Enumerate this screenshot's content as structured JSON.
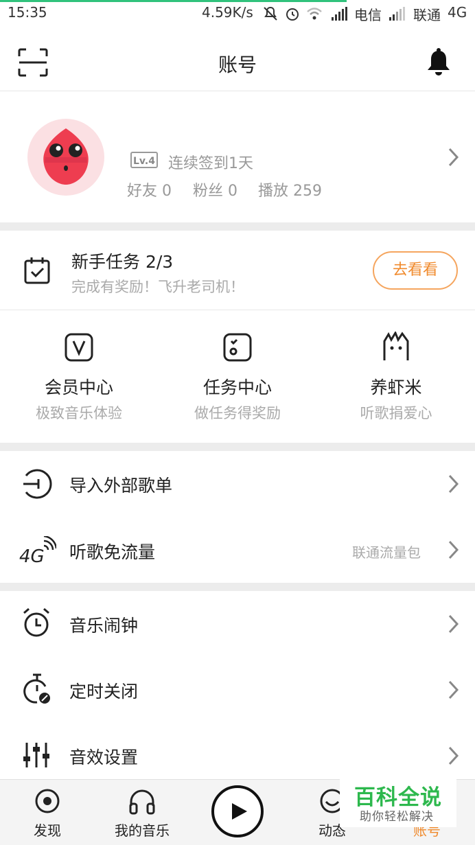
{
  "status_bar": {
    "time": "15:35",
    "speed": "4.59K/s",
    "carrier1": "电信",
    "carrier2": "联通",
    "network": "4G"
  },
  "header": {
    "title": "账号",
    "scan_icon": "scan-icon",
    "bell_icon": "bell-icon"
  },
  "profile": {
    "level": "Lv.4",
    "checkin": "连续签到1天",
    "friends": "好友 0",
    "fans": "粉丝 0",
    "plays": "播放 259"
  },
  "task": {
    "title": "新手任务 2/3",
    "subtitle": "完成有奖励！飞升老司机！",
    "button": "去看看"
  },
  "grid": [
    {
      "title": "会员中心",
      "subtitle": "极致音乐体验",
      "icon": "vip-icon"
    },
    {
      "title": "任务中心",
      "subtitle": "做任务得奖励",
      "icon": "task-center-icon"
    },
    {
      "title": "养虾米",
      "subtitle": "听歌捐爱心",
      "icon": "shrimp-icon"
    }
  ],
  "menu": [
    {
      "label": "导入外部歌单",
      "right": "",
      "icon": "import-icon"
    },
    {
      "label": "听歌免流量",
      "right": "联通流量包",
      "icon": "4g-icon"
    },
    {
      "label": "音乐闹钟",
      "right": "",
      "icon": "alarm-icon"
    },
    {
      "label": "定时关闭",
      "right": "",
      "icon": "timer-icon"
    },
    {
      "label": "音效设置",
      "right": "",
      "icon": "equalizer-icon"
    }
  ],
  "bottom_nav": [
    {
      "label": "发现",
      "icon": "discover-icon"
    },
    {
      "label": "我的音乐",
      "icon": "headphones-icon"
    },
    {
      "label": "",
      "icon": "play-icon"
    },
    {
      "label": "动态",
      "icon": "feed-icon"
    },
    {
      "label": "账号",
      "icon": "account-icon"
    }
  ],
  "watermark": {
    "title": "百科全说",
    "subtitle": "助你轻松解决"
  },
  "colors": {
    "accent_orange": "#f08a2c",
    "progress_green": "#31c27c",
    "watermark_green": "#2db84d"
  }
}
